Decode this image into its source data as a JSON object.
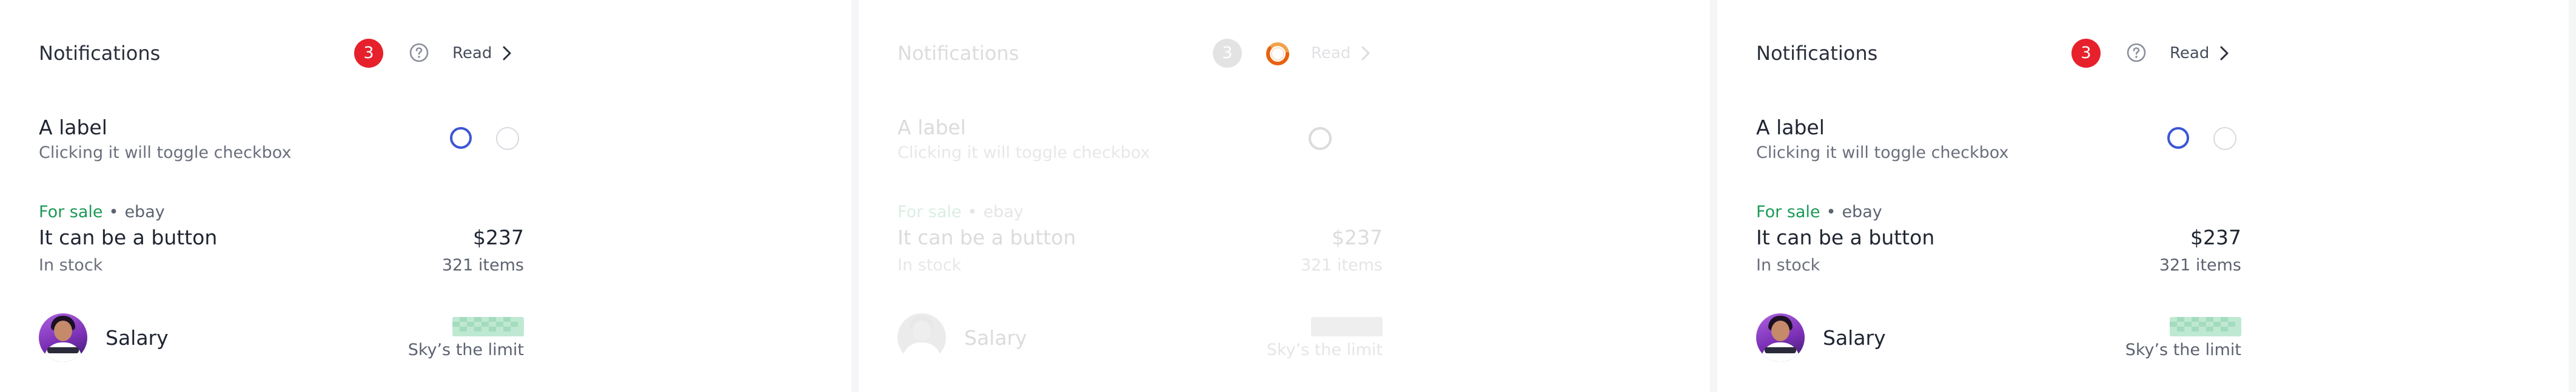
{
  "panels": [
    {
      "state": "default",
      "header": {
        "title": "Notifications",
        "badge_count": "3",
        "read_label": "Read",
        "help_icon": "help-circle-icon",
        "chevron_icon": "chevron-right-icon"
      },
      "label_row": {
        "title": "A label",
        "subtitle": "Clicking it will toggle checkbox"
      },
      "item_row": {
        "status": "For sale",
        "store": "ebay",
        "title": "It can be a button",
        "stock": "In stock",
        "price": "$237",
        "count": "321 items"
      },
      "salary_row": {
        "title": "Salary",
        "caption": "Sky’s the limit"
      }
    },
    {
      "state": "loading",
      "header": {
        "title": "Notifications",
        "badge_count": "3",
        "read_label": "Read",
        "loader_icon": "spinner-icon",
        "chevron_icon": "chevron-right-icon"
      },
      "label_row": {
        "title": "A label",
        "subtitle": "Clicking it will toggle checkbox"
      },
      "item_row": {
        "status": "For sale",
        "store": "ebay",
        "title": "It can be a button",
        "stock": "In stock",
        "price": "$237",
        "count": "321 items"
      },
      "salary_row": {
        "title": "Salary",
        "caption": "Sky’s the limit"
      }
    },
    {
      "state": "default",
      "header": {
        "title": "Notifications",
        "badge_count": "3",
        "read_label": "Read",
        "help_icon": "help-circle-icon",
        "chevron_icon": "chevron-right-icon"
      },
      "label_row": {
        "title": "A label",
        "subtitle": "Clicking it will toggle checkbox"
      },
      "item_row": {
        "status": "For sale",
        "store": "ebay",
        "title": "It can be a button",
        "stock": "In stock",
        "price": "$237",
        "count": "321 items"
      },
      "salary_row": {
        "title": "Salary",
        "caption": "Sky’s the limit"
      }
    }
  ],
  "colors": {
    "badge": "#e6212c",
    "radio_selected": "#3b56d4",
    "sale": "#1c9a57",
    "loader": "#e8600f"
  }
}
